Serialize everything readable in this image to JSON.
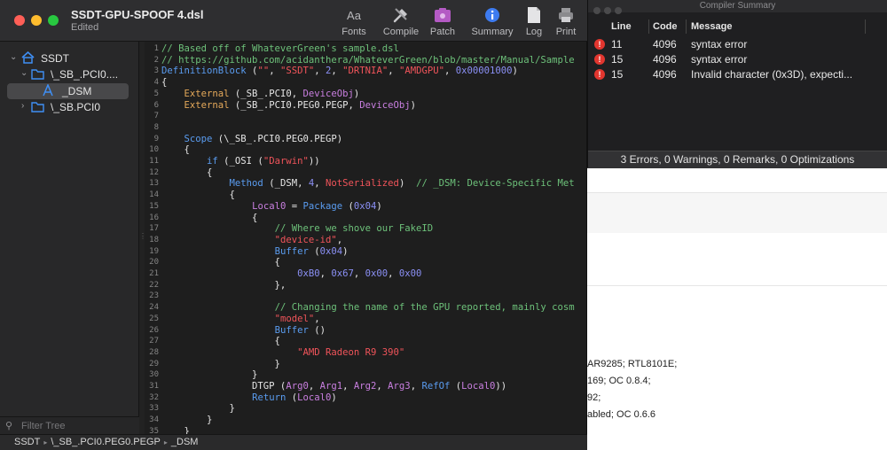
{
  "window": {
    "title": "SSDT-GPU-SPOOF 4.dsl",
    "subtitle": "Edited"
  },
  "toolbar": {
    "buttons": [
      {
        "label": "Fonts",
        "icon": "fonts-icon"
      },
      {
        "label": "Compile",
        "icon": "compile-icon"
      },
      {
        "label": "Patch",
        "icon": "patch-icon"
      },
      {
        "label": "Summary",
        "icon": "info-icon"
      },
      {
        "label": "Log",
        "icon": "log-icon"
      },
      {
        "label": "Print",
        "icon": "print-icon"
      }
    ]
  },
  "sidebar": {
    "tree": [
      {
        "label": "SSDT",
        "icon": "home-icon"
      },
      {
        "label": "\\_SB_.PCI0....",
        "icon": "folder-icon"
      },
      {
        "label": "_DSM",
        "icon": "method-icon"
      },
      {
        "label": "\\_SB.PCI0",
        "icon": "folder-icon"
      }
    ],
    "filter_placeholder": "Filter Tree"
  },
  "editor": {
    "line_numbers": [
      "1",
      "2",
      "3",
      "4",
      "5",
      "6",
      "7",
      "8",
      "9",
      "10",
      "11",
      "12",
      "13",
      "14",
      "15",
      "16",
      "17",
      "18",
      "19",
      "20",
      "21",
      "22",
      "23",
      "24",
      "25",
      "26",
      "27",
      "28",
      "29",
      "30",
      "31",
      "32",
      "33",
      "34",
      "35"
    ],
    "lines": [
      [
        {
          "t": "// Based off of WhateverGreen's sample.dsl",
          "c": "c"
        }
      ],
      [
        {
          "t": "// https://github.com/acidanthera/WhateverGreen/blob/master/Manual/Sample",
          "c": "c"
        }
      ],
      [
        {
          "t": "DefinitionBlock",
          "c": "k"
        },
        {
          "t": " ("
        },
        {
          "t": "\"\"",
          "c": "s"
        },
        {
          "t": ", "
        },
        {
          "t": "\"SSDT\"",
          "c": "s"
        },
        {
          "t": ", "
        },
        {
          "t": "2",
          "c": "n"
        },
        {
          "t": ", "
        },
        {
          "t": "\"DRTNIA\"",
          "c": "s"
        },
        {
          "t": ", "
        },
        {
          "t": "\"AMDGPU\"",
          "c": "s"
        },
        {
          "t": ", "
        },
        {
          "t": "0x00001000",
          "c": "n"
        },
        {
          "t": ")"
        }
      ],
      [
        {
          "t": "{"
        }
      ],
      [
        {
          "t": "    "
        },
        {
          "t": "External",
          "c": "e"
        },
        {
          "t": " (_SB_.PCI0, "
        },
        {
          "t": "DeviceObj",
          "c": "i"
        },
        {
          "t": ")"
        }
      ],
      [
        {
          "t": "    "
        },
        {
          "t": "External",
          "c": "e"
        },
        {
          "t": " (_SB_.PCI0.PEG0.PEGP, "
        },
        {
          "t": "DeviceObj",
          "c": "i"
        },
        {
          "t": ")"
        }
      ],
      [
        {
          "t": ""
        }
      ],
      [
        {
          "t": ""
        }
      ],
      [
        {
          "t": "    "
        },
        {
          "t": "Scope",
          "c": "k"
        },
        {
          "t": " (\\_SB_.PCI0.PEG0.PEGP)"
        }
      ],
      [
        {
          "t": "    {"
        }
      ],
      [
        {
          "t": "        "
        },
        {
          "t": "if",
          "c": "k"
        },
        {
          "t": " (_OSI ("
        },
        {
          "t": "\"Darwin\"",
          "c": "s"
        },
        {
          "t": "))"
        }
      ],
      [
        {
          "t": "        {"
        }
      ],
      [
        {
          "t": "            "
        },
        {
          "t": "Method",
          "c": "k"
        },
        {
          "t": " (_DSM, "
        },
        {
          "t": "4",
          "c": "n"
        },
        {
          "t": ", "
        },
        {
          "t": "NotSerialized",
          "c": "s"
        },
        {
          "t": ")  "
        },
        {
          "t": "// _DSM: Device-Specific Met",
          "c": "c"
        }
      ],
      [
        {
          "t": "            {"
        }
      ],
      [
        {
          "t": "                "
        },
        {
          "t": "Local0",
          "c": "i"
        },
        {
          "t": " = "
        },
        {
          "t": "Package",
          "c": "k"
        },
        {
          "t": " ("
        },
        {
          "t": "0x04",
          "c": "n"
        },
        {
          "t": ")"
        }
      ],
      [
        {
          "t": "                {"
        }
      ],
      [
        {
          "t": "                    "
        },
        {
          "t": "// Where we shove our FakeID",
          "c": "c"
        }
      ],
      [
        {
          "t": "                    "
        },
        {
          "t": "\"device-id\"",
          "c": "s"
        },
        {
          "t": ","
        }
      ],
      [
        {
          "t": "                    "
        },
        {
          "t": "Buffer",
          "c": "k"
        },
        {
          "t": " ("
        },
        {
          "t": "0x04",
          "c": "n"
        },
        {
          "t": ")"
        }
      ],
      [
        {
          "t": "                    {"
        }
      ],
      [
        {
          "t": "                        "
        },
        {
          "t": "0xB0",
          "c": "n"
        },
        {
          "t": ", "
        },
        {
          "t": "0x67",
          "c": "n"
        },
        {
          "t": ", "
        },
        {
          "t": "0x00",
          "c": "n"
        },
        {
          "t": ", "
        },
        {
          "t": "0x00",
          "c": "n"
        }
      ],
      [
        {
          "t": "                    },"
        }
      ],
      [
        {
          "t": ""
        }
      ],
      [
        {
          "t": "                    "
        },
        {
          "t": "// Changing the name of the GPU reported, mainly cosm",
          "c": "c"
        }
      ],
      [
        {
          "t": "                    "
        },
        {
          "t": "\"model\"",
          "c": "s"
        },
        {
          "t": ","
        }
      ],
      [
        {
          "t": "                    "
        },
        {
          "t": "Buffer",
          "c": "k"
        },
        {
          "t": " ()"
        }
      ],
      [
        {
          "t": "                    {"
        }
      ],
      [
        {
          "t": "                        "
        },
        {
          "t": "\"AMD Radeon R9 390\"",
          "c": "s"
        }
      ],
      [
        {
          "t": "                    }"
        }
      ],
      [
        {
          "t": "                }"
        }
      ],
      [
        {
          "t": "                DTGP ("
        },
        {
          "t": "Arg0",
          "c": "i"
        },
        {
          "t": ", "
        },
        {
          "t": "Arg1",
          "c": "i"
        },
        {
          "t": ", "
        },
        {
          "t": "Arg2",
          "c": "i"
        },
        {
          "t": ", "
        },
        {
          "t": "Arg3",
          "c": "i"
        },
        {
          "t": ", "
        },
        {
          "t": "RefOf",
          "c": "k"
        },
        {
          "t": " ("
        },
        {
          "t": "Local0",
          "c": "i"
        },
        {
          "t": "))"
        }
      ],
      [
        {
          "t": "                "
        },
        {
          "t": "Return",
          "c": "k"
        },
        {
          "t": " ("
        },
        {
          "t": "Local0",
          "c": "i"
        },
        {
          "t": ")"
        }
      ],
      [
        {
          "t": "            }"
        }
      ],
      [
        {
          "t": "        }"
        }
      ],
      [
        {
          "t": "    }"
        }
      ]
    ]
  },
  "statusbar": {
    "crumbs": [
      "SSDT",
      "\\_SB_.PCI0.PEG0.PEGP",
      "_DSM"
    ]
  },
  "compiler": {
    "title": "Compiler Summary",
    "columns": [
      "Line",
      "Code",
      "Message"
    ],
    "rows": [
      {
        "line": "11",
        "code": "4096",
        "message": "syntax error"
      },
      {
        "line": "15",
        "code": "4096",
        "message": "syntax error"
      },
      {
        "line": "15",
        "code": "4096",
        "message": "Invalid character (0x3D), expecti..."
      }
    ],
    "summary": "3 Errors, 0 Warnings, 0 Remarks, 0 Optimizations"
  },
  "background": {
    "lines": [
      "AR9285; RTL8101E;",
      "169; OC 0.8.4;",
      "92;",
      "abled; OC 0.6.6"
    ]
  },
  "colors": {
    "close": "#ff5f57",
    "minimize": "#febc2e",
    "zoom": "#28c840",
    "error": "#e2362f",
    "comment": "#6dc17a",
    "keyword": "#5a9cf0",
    "string": "#f0545a",
    "number": "#8b90f5"
  }
}
